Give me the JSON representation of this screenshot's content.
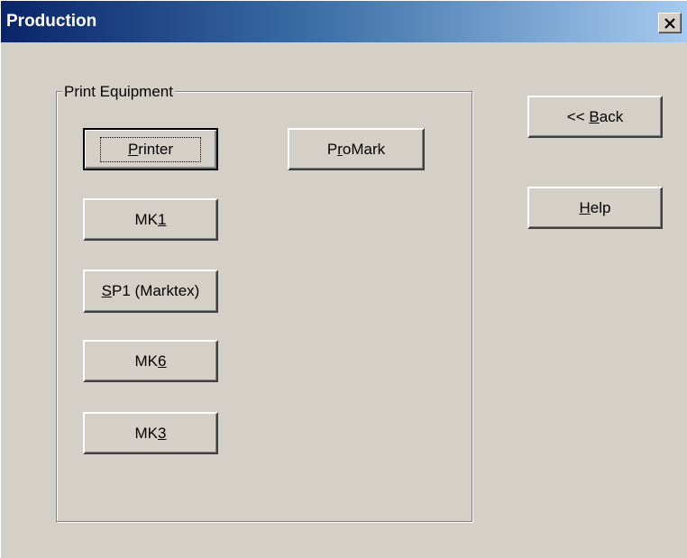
{
  "window": {
    "title": "Production",
    "close_glyph": "×"
  },
  "group": {
    "legend": "Print Equipment"
  },
  "buttons": {
    "printer": {
      "pre": "",
      "key": "P",
      "post": "rinter"
    },
    "promark": {
      "pre": "P",
      "key": "r",
      "post": "oMark"
    },
    "mk1": {
      "pre": "MK",
      "key": "1",
      "post": ""
    },
    "sp1": {
      "pre": "",
      "key": "S",
      "post": "P1 (Marktex)"
    },
    "mk6": {
      "pre": "MK",
      "key": "6",
      "post": ""
    },
    "mk3": {
      "pre": "MK",
      "key": "3",
      "post": ""
    },
    "back": {
      "pre": "<< ",
      "key": "B",
      "post": "ack"
    },
    "help": {
      "pre": "",
      "key": "H",
      "post": "elp"
    }
  },
  "icons": {
    "close": "close-icon"
  }
}
